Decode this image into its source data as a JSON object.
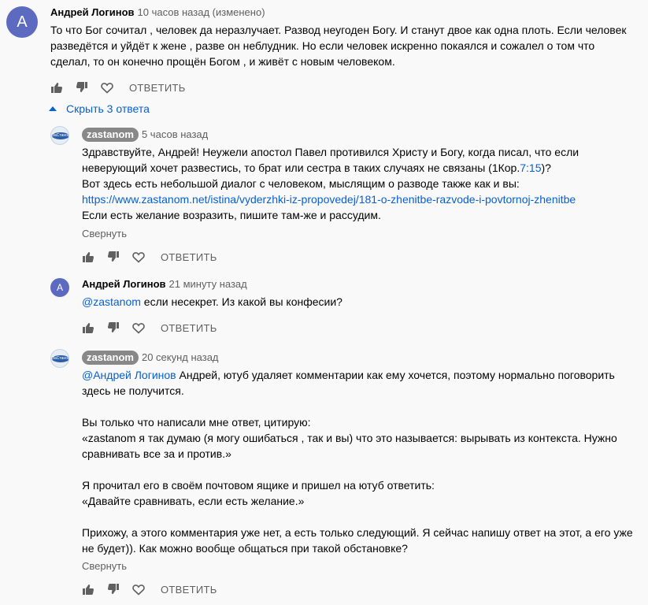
{
  "comments": [
    {
      "avatar_letter": "A",
      "author": "Андрей Логинов",
      "time": "10 часов назад (изменено)",
      "text": "То что Бог сочитал , человек да неразлучает. Развод неугоден Богу. И станут двое как одна плоть. Если человек\nразведётся и уйдёт к жене , разве он неблудник. Но если человек искренно  покаялся и сожалел о том что\nсделал,  то он конечно прощён Богом , и живёт с новым человеком.",
      "reply_label": "ОТВЕТИТЬ"
    }
  ],
  "replies_toggle": "Скрыть 3 ответа",
  "replies": [
    {
      "author": "zastanom",
      "time": "5 часов назад",
      "text_part1": "Здравствуйте, Андрей! Неужели апостол Павел противился Христу и Богу, когда писал, что если\nневерующий хочет развестись, то брат или сестра в таких случаях не связаны (1Кор.",
      "ref_link": "7:15",
      "text_part2": ")?\nВот здесь есть небольшой диалог с человеком, мыслящим о разводе также как и вы:",
      "url": "https://www.zastanom.net/istina/vyderzhki-iz-propovedej/181-o-zhenitbe-razvode-i-povtornoj-zhenitbe",
      "text_part3": "Если есть желание возразить, пишите там-же и рассудим.",
      "collapse_label": "Свернуть",
      "reply_label": "ОТВЕТИТЬ"
    },
    {
      "avatar_letter": "A",
      "author": "Андрей Логинов",
      "time": "21 минуту назад",
      "mention": "@zastanom",
      "text": " если несекрет. Из какой вы конфесии?",
      "reply_label": "ОТВЕТИТЬ"
    },
    {
      "author": "zastanom",
      "time": "20 секунд назад",
      "mention": "@Андрей Логинов",
      "text": " Андрей, ютуб удаляет комментарии как ему хочется, поэтому нормально поговорить\nздесь не получится.\n\nВы только что написали мне ответ, цитирую:\n«zastanom я так думаю (я могу ошибаться , так и вы) что это называется: вырывать из контекста. Нужно\nсравнивать все за и против.»\n\nЯ прочитал его в своём почтовом ящике и пришел на ютуб ответить:\n«Давайте сравнивать, если есть желание.»\n\nПрихожу, а этого комментария уже нет, а есть только следующий. Я сейчас напишу ответ на этот, а его уже\nне будет)). Как можно вообще общаться при такой обстановке?",
      "collapse_label": "Свернуть",
      "reply_label": "ОТВЕТИТЬ"
    }
  ],
  "logo_text": "ЗаСтаном",
  "colors": {
    "link": "#065fd4",
    "avatar": "#5c6bc0",
    "muted": "#606060"
  }
}
